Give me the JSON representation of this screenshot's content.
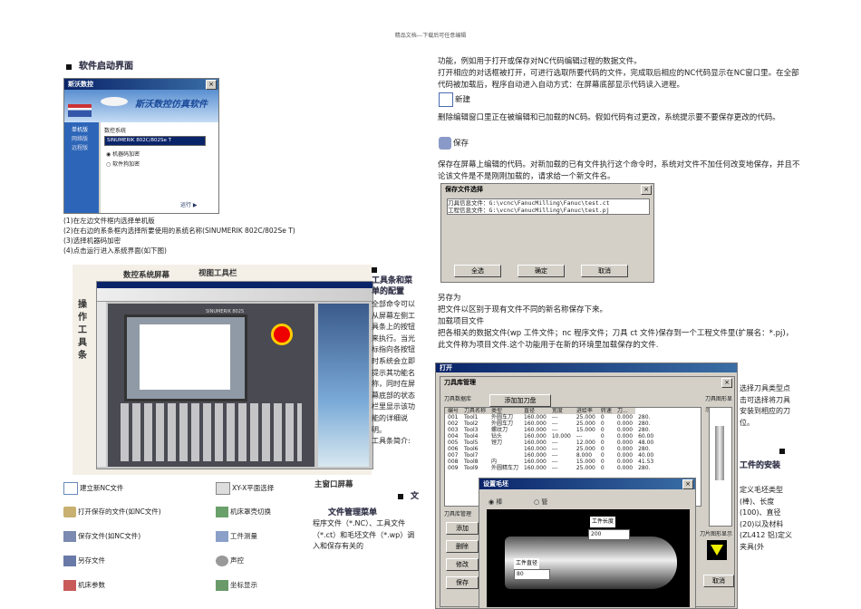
{
  "header": "精品文档---下载后可任意编辑",
  "left": {
    "section1_title": "软件启动界面",
    "startup_window": {
      "title": "斯沃数控",
      "banner": "斯沃数控仿真软件",
      "menu": [
        "单机版",
        "网络版",
        "远程版"
      ],
      "label": "数控系统",
      "select": "SINUMERIK 802C/802Se T",
      "radio1": "机器码加密",
      "radio2": "软件狗加密",
      "run": "运行 ▶"
    },
    "steps": [
      "(1)在左边文件框内选择单机版",
      "(2)在右边的系条框内选择所要使用的系统名称(SINUMERIK  802C/802Se  T)",
      "(3)选择机器码加密",
      "(4)点击运行进入系统界面(如下图)"
    ],
    "cnc_labels": {
      "screen": "数控系统屏幕",
      "view_toolbar": "视图工具栏",
      "op_toolbar": "操作工具条",
      "main_window": "主窗口屏幕"
    },
    "cnc_window_title": "SINUMERIK 802S",
    "right_col": {
      "heading": "工具条和菜单的配置",
      "body": "全部命令可以从屏幕左侧工具条上的按钮来执行。当光标指向各按钮时系统会立即提示其功能名称，同时在屏幕底部的状态栏里显示该功能的详细说明。",
      "intro": "工具条简介:",
      "file_heading": "文件管理菜单",
      "file_body": "程序文件（*.NC）、工具文件（*.ct）和毛坯文件（*.wp）调入和保存有关的"
    },
    "toolbar_items": [
      [
        "建立新NC文件",
        "XY-X平面选择"
      ],
      [
        "打开保存的文件(如NC文件)",
        "机床罩壳切换"
      ],
      [
        "保存文件(如NC文件)",
        "工件测量"
      ],
      [
        "另存文件",
        "声控"
      ],
      [
        "机床参数",
        "坐标显示"
      ]
    ]
  },
  "right": {
    "p1": "功能，例如用于打开或保存对NC代码编辑过程的数据文件。",
    "p2": "打开相应的对话框被打开，可进行选取所要代码的文件，完成取后相应的NC代码显示在NC窗口里。在全部代码被加载后，程序自动进入自动方式：在屏幕底部显示代码读入进程。",
    "new_label": "新建",
    "p3": "删除编辑窗口里正在被编辑和已加载的NC码。假如代码有过更改，系统提示要不要保存更改的代码。",
    "save_label": "保存",
    "p4": "保存在屏幕上编辑的代码。对新加载的已有文件执行这个命令时，系统对文件不加任何改变地保存，并且不论该文件是不是刚刚加载的，请求给一个新文件名。",
    "save_dialog": {
      "title": "保存文件选择",
      "line1": "刀具信息文件：G:\\vcnc\\FanucMilling\\Fanuc\\test.ct",
      "line2": "工程信息文件：G:\\vcnc\\FanucMilling\\Fanuc\\test.pj",
      "btn_all": "全选",
      "btn_ok": "确定",
      "btn_cancel": "取消"
    },
    "saveas_title": "另存为",
    "saveas_body": "把文件以区别于现有文件不同的新名称保存下来。",
    "project_title": "加载项目文件",
    "project_body": "把各相关的数据文件(wp 工件文件；nc 程序文件；刀具 ct 文件)保存到一个工程文件里(扩展名：*.pj)，此文件称为项目文件.这个功能用于在新的环境里加载保存的文件.",
    "tool_dialog": {
      "outer_title": "打开",
      "title": "刀具库管理",
      "add_btn": "添加加刀盘",
      "db_label": "刀具数据库",
      "headers": [
        "编号",
        "刀具名称",
        "类型",
        "直径",
        "宽度",
        "进给率",
        "转速",
        "刀..."
      ],
      "rows": [
        [
          "001",
          "Tool1",
          "外圆车刀",
          "160.000",
          "---",
          "25.000",
          "0",
          "0.000",
          "280."
        ],
        [
          "002",
          "Tool2",
          "外圆车刀",
          "160.000",
          "---",
          "25.000",
          "0",
          "0.000",
          "280."
        ],
        [
          "003",
          "Tool3",
          "螺纹刀",
          "160.000",
          "---",
          "15.000",
          "0",
          "0.000",
          "280."
        ],
        [
          "004",
          "Tool4",
          "钻头",
          "160.000",
          "10.000",
          "---",
          "0",
          "0.000",
          "60.00"
        ],
        [
          "005",
          "Tool5",
          "镗刀",
          "160.000",
          "---",
          "12.000",
          "0",
          "0.000",
          "48.00"
        ],
        [
          "006",
          "Tool6",
          "",
          "160.000",
          "---",
          "25.000",
          "0",
          "0.000",
          "280."
        ],
        [
          "007",
          "Tool7",
          "",
          "160.000",
          "---",
          "8.000",
          "0",
          "0.000",
          "40.00"
        ],
        [
          "008",
          "Tool8",
          "内",
          "160.000",
          "---",
          "15.000",
          "0",
          "0.000",
          "41.53"
        ],
        [
          "009",
          "Tool9",
          "外圆精车刀",
          "160.000",
          "---",
          "25.000",
          "0",
          "0.000",
          "280."
        ]
      ],
      "side_label": "刀具图形显示",
      "mgr_label": "刀具库管理",
      "left_btns": [
        "添加",
        "删除",
        "修改",
        "保存"
      ],
      "side_label2": "刀片图形显示",
      "cancel": "取消"
    },
    "blank_dialog": {
      "title": "设置毛坯",
      "radio1": "棒",
      "radio2": "管",
      "length_label": "工件长度",
      "length_value": "200",
      "diameter_label": "工件直径",
      "diameter_value": "80"
    },
    "side_text1": "选择刀具类型点击可选择将刀具安装到相应的刀位。",
    "side_heading": "工件的安装",
    "side_text2": "定义毛坯类型(棒)、长度(100)、直径(20)以及材料(ZL412 铝)定义夹具(外"
  }
}
